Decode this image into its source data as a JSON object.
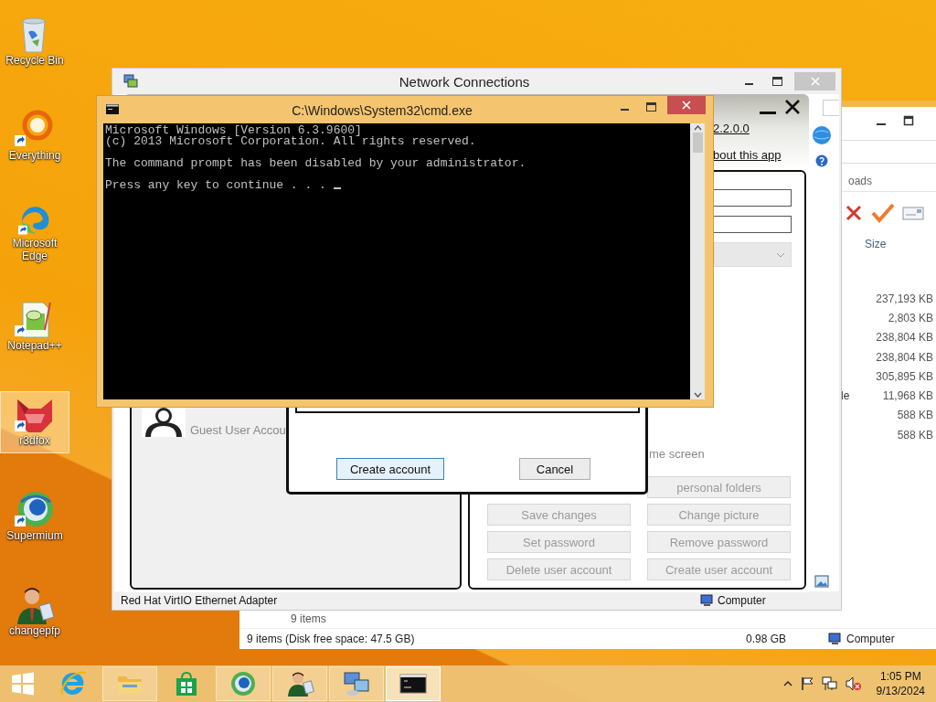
{
  "desktop_icons": [
    {
      "label": "Recycle Bin",
      "kind": "bin",
      "shortcut": false,
      "selected": false
    },
    {
      "label": "Everything",
      "kind": "ring",
      "shortcut": true,
      "selected": false
    },
    {
      "label": "Microsoft Edge",
      "kind": "swirl",
      "shortcut": true,
      "selected": false
    },
    {
      "label": "Notepad++",
      "kind": "notepad",
      "shortcut": true,
      "selected": false
    },
    {
      "label": "r3dfox",
      "kind": "mask",
      "shortcut": true,
      "selected": true
    },
    {
      "label": "Supermium",
      "kind": "globe",
      "shortcut": true,
      "selected": false
    },
    {
      "label": "changepfp",
      "kind": "person",
      "shortcut": false,
      "selected": false
    }
  ],
  "explorer": {
    "breadcrumb": "oads",
    "column": "Size",
    "rows": [
      {
        "size": "237,193 KB"
      },
      {
        "size": "2,803 KB"
      },
      {
        "size": "238,804 KB"
      },
      {
        "size": "238,804 KB"
      },
      {
        "size": "305,895 KB"
      },
      {
        "column_1": "le",
        "size": "11,968 KB"
      },
      {
        "size": "588 KB"
      },
      {
        "size": "588 KB"
      }
    ],
    "items_line": "9 items",
    "status_bar": [
      "9 items (Disk free space: 47.5 GB)",
      "0.98 GB",
      "Computer"
    ]
  },
  "network_window": {
    "title": "Network Connections",
    "status_bar": [
      "Red Hat VirtIO Ethernet Adapter",
      "Computer"
    ]
  },
  "account_app": {
    "version_link": "2.2.0.0",
    "about_link": "bout this app",
    "users": [
      {
        "name": "Guest User Accou",
        "selected": false
      }
    ],
    "option_text": "me screen",
    "folders_button": {
      "label": "personal folders",
      "disabled": true
    },
    "buttons": [
      {
        "label": "Save changes",
        "disabled": true
      },
      {
        "label": "Change picture",
        "disabled": true
      },
      {
        "label": "Set password",
        "disabled": true
      },
      {
        "label": "Remove password",
        "disabled": true
      },
      {
        "label": "Delete user account",
        "disabled": true
      },
      {
        "label": "Create user account",
        "disabled": true
      }
    ]
  },
  "dialog": {
    "buttons": [
      {
        "label": "Create account",
        "default": true
      },
      {
        "label": "Cancel",
        "default": false
      }
    ]
  },
  "cmd": {
    "title": "C:\\Windows\\System32\\cmd.exe",
    "blocks": [
      [
        "Microsoft Windows [Version 6.3.9600]",
        "(c) 2013 Microsoft Corporation. All rights reserved."
      ],
      [
        "The command prompt has been disabled by your administrator."
      ],
      [
        "Press any key to continue . . ."
      ]
    ]
  },
  "taskbar": {
    "apps": [
      {
        "kind": "ie",
        "open": false,
        "selected": false
      },
      {
        "kind": "folder",
        "open": true,
        "selected": false
      },
      {
        "kind": "store",
        "open": false,
        "selected": false
      },
      {
        "kind": "globe",
        "open": true,
        "selected": false
      },
      {
        "kind": "person",
        "open": true,
        "selected": false
      },
      {
        "kind": "network",
        "open": true,
        "selected": false
      },
      {
        "kind": "console",
        "open": true,
        "selected": true
      }
    ],
    "time": "1:05 PM",
    "date": "9/13/2024"
  }
}
